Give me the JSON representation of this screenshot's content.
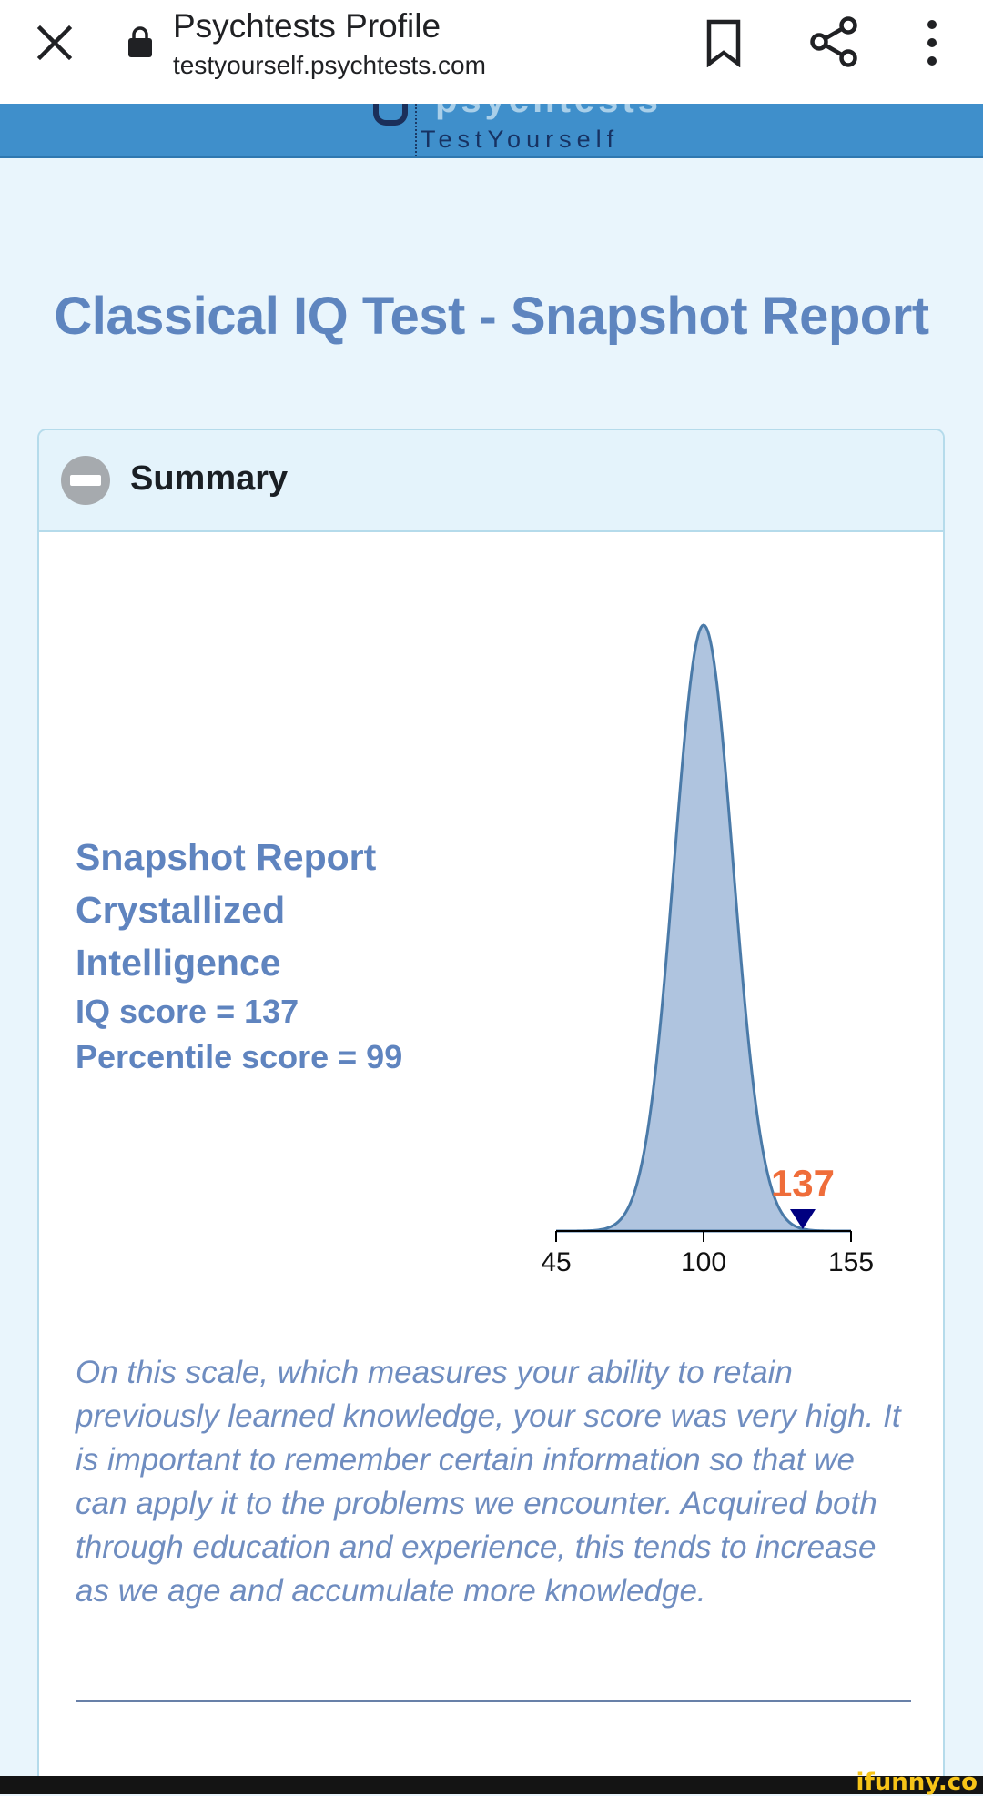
{
  "browser": {
    "page_title": "Psychtests Profile",
    "url": "testyourself.psychtests.com",
    "icons": [
      "close-icon",
      "lock-icon",
      "bookmark-icon",
      "share-icon",
      "more-vert-icon"
    ]
  },
  "site_header": {
    "logo_text": "psychtests",
    "tagline": "TestYourself"
  },
  "page": {
    "heading": "Classical IQ Test - Snapshot Report"
  },
  "summary": {
    "label": "Summary",
    "report_title": "Snapshot Report",
    "scale_line1": "Crystallized",
    "scale_line2": "Intelligence",
    "iq_line": "IQ score = 137",
    "percentile_line": "Percentile score = 99",
    "description": "On this scale, which measures your ability to retain previously learned knowledge, your score was very high. It is important to remember certain information so that we can apply it to the problems we encounter. Acquired both through education and experience, this tends to increase as we age and accumulate more knowledge."
  },
  "chart_data": {
    "type": "area",
    "distribution": "normal",
    "x_ticks": [
      45,
      100,
      155
    ],
    "xlim": [
      45,
      155
    ],
    "mean": 100,
    "marker": {
      "value": 137,
      "label": "137"
    },
    "colors": {
      "fill": "#afc4df",
      "stroke": "#4a7aa8",
      "marker": "#000080",
      "marker_label": "#ef6d3a"
    }
  },
  "watermark": "ifunny.co"
}
